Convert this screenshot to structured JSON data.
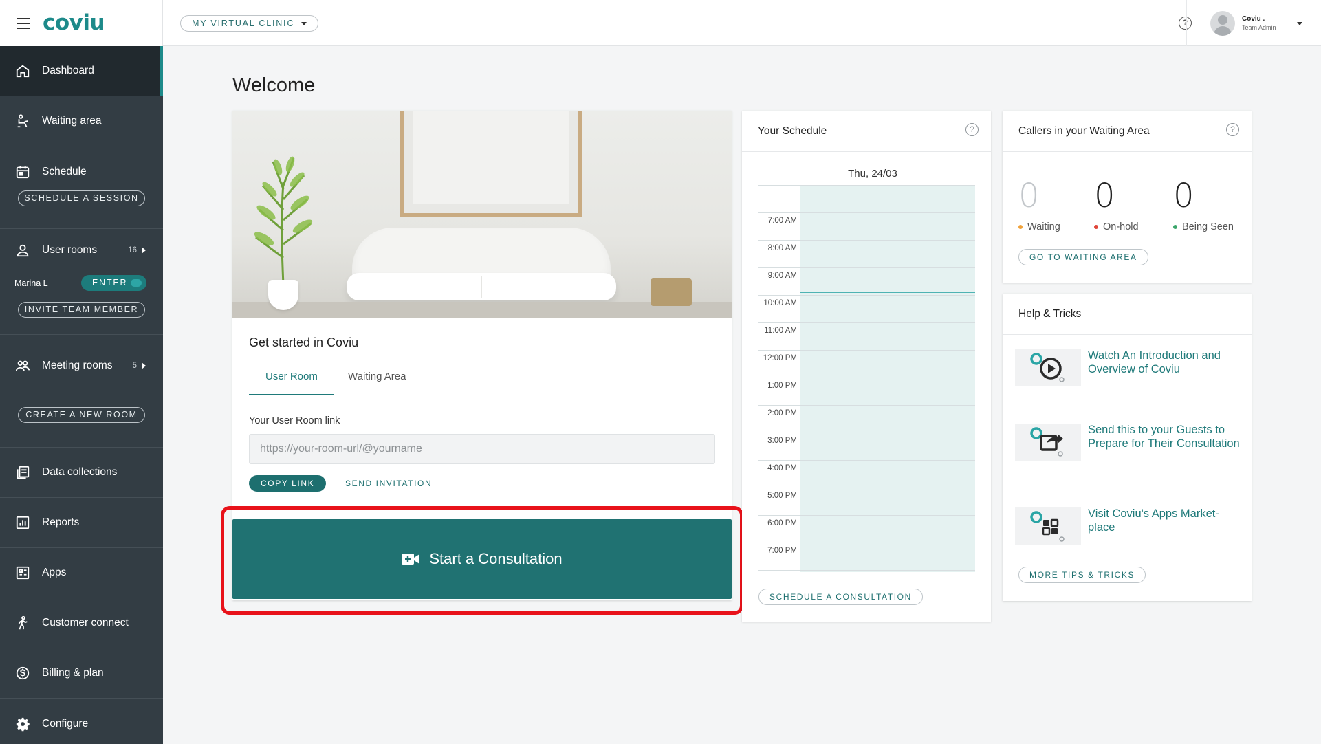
{
  "app": {
    "logo": "coviu"
  },
  "topbar": {
    "clinic_label": "MY VIRTUAL CLINIC",
    "user_name": "Coviu .",
    "user_role": "Team Admin"
  },
  "sidebar": {
    "dashboard": "Dashboard",
    "waiting_area": "Waiting area",
    "schedule": "Schedule",
    "schedule_session_btn": "SCHEDULE A SESSION",
    "user_rooms": "User rooms",
    "user_rooms_count": "16",
    "room_user": "Marina L",
    "enter_label": "ENTER",
    "invite_btn": "INVITE TEAM MEMBER",
    "meeting_rooms": "Meeting rooms",
    "meeting_rooms_count": "5",
    "create_room_btn": "CREATE A NEW ROOM",
    "data_collections": "Data collections",
    "reports": "Reports",
    "apps": "Apps",
    "customer_connect": "Customer connect",
    "billing": "Billing & plan",
    "configure": "Configure"
  },
  "main": {
    "title": "Welcome",
    "get_started": {
      "title": "Get started in Coviu",
      "tabs": [
        "User Room",
        "Waiting Area"
      ],
      "link_label": "Your User Room link",
      "link_placeholder": "https://your-room-url/@yourname",
      "copy_btn": "COPY LINK",
      "send_btn": "SEND INVITATION"
    },
    "start_btn": "Start a Consultation",
    "schedule": {
      "title": "Your Schedule",
      "date": "Thu, 24/03",
      "times": [
        "7:00 AM",
        "8:00 AM",
        "9:00 AM",
        "10:00 AM",
        "11:00 AM",
        "12:00 PM",
        "1:00 PM",
        "2:00 PM",
        "3:00 PM",
        "4:00 PM",
        "5:00 PM",
        "6:00 PM",
        "7:00 PM"
      ],
      "btn": "SCHEDULE A CONSULTATION"
    },
    "callers": {
      "title": "Callers in your Waiting Area",
      "waiting_count": "0",
      "waiting_label": "Waiting",
      "onhold_count": "0",
      "onhold_label": "On-hold",
      "seen_count": "0",
      "seen_label": "Being Seen",
      "btn": "GO TO WAITING AREA"
    },
    "help": {
      "title": "Help & Tricks",
      "tips": [
        "Watch An Introduction and Overview of Coviu",
        "Send this to your Guests to Prepare for Their Consultation",
        "Visit Coviu's Apps Market-place"
      ],
      "btn": "MORE TIPS & TRICKS"
    }
  },
  "colors": {
    "accent": "#1d8a8a",
    "sidebar_bg": "#333d44",
    "primary_button": "#207272",
    "highlight": "#e8121a",
    "waiting_dot": "#f0a23a",
    "onhold_dot": "#e0463a",
    "seen_dot": "#3aa56a"
  }
}
